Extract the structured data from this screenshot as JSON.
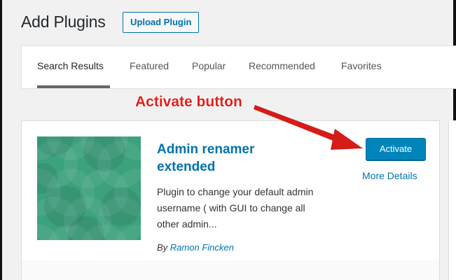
{
  "header": {
    "title": "Add Plugins",
    "upload_button": "Upload Plugin"
  },
  "tabs": [
    {
      "label": "Search Results",
      "current": true
    },
    {
      "label": "Featured"
    },
    {
      "label": "Popular"
    },
    {
      "label": "Recommended"
    },
    {
      "label": "Favorites"
    }
  ],
  "annotation": {
    "text": "Activate button",
    "color": "#e0201b"
  },
  "plugin": {
    "name": "Admin renamer extended",
    "description": "Plugin to change your default admin username ( with GUI to change all other admin...",
    "author_prefix": "By",
    "author": "Ramon Fincken",
    "activate_label": "Activate",
    "more_details_label": "More Details",
    "thumbnail_color": "#2e9a74"
  },
  "colors": {
    "link": "#0073aa",
    "primary_button": "#0085ba"
  }
}
